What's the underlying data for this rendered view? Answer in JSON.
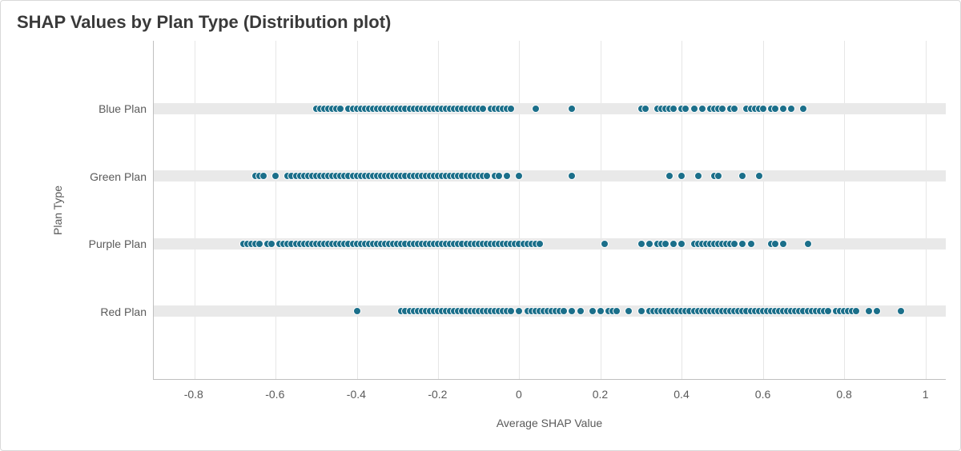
{
  "title": "SHAP Values by Plan Type (Distribution plot)",
  "ylabel": "Plan Type",
  "xlabel": "Average SHAP Value",
  "chart_data": {
    "type": "scatter",
    "xlim": [
      -0.9,
      1.05
    ],
    "xticks": [
      -0.8,
      -0.6,
      -0.4,
      -0.2,
      0,
      0.2,
      0.4,
      0.6,
      0.8,
      1
    ],
    "categories": [
      "Blue Plan",
      "Green Plan",
      "Purple Plan",
      "Red Plan"
    ],
    "dot_color": "#1b6f8a",
    "series": [
      {
        "name": "Blue Plan",
        "values": [
          -0.5,
          -0.49,
          -0.48,
          -0.47,
          -0.46,
          -0.45,
          -0.44,
          -0.42,
          -0.41,
          -0.4,
          -0.39,
          -0.38,
          -0.37,
          -0.36,
          -0.35,
          -0.34,
          -0.33,
          -0.32,
          -0.31,
          -0.3,
          -0.29,
          -0.28,
          -0.27,
          -0.26,
          -0.25,
          -0.24,
          -0.23,
          -0.22,
          -0.21,
          -0.2,
          -0.19,
          -0.18,
          -0.17,
          -0.16,
          -0.15,
          -0.14,
          -0.13,
          -0.12,
          -0.11,
          -0.1,
          -0.09,
          -0.07,
          -0.06,
          -0.05,
          -0.04,
          -0.03,
          -0.02,
          0.04,
          0.13,
          0.3,
          0.31,
          0.34,
          0.35,
          0.36,
          0.37,
          0.38,
          0.4,
          0.41,
          0.43,
          0.45,
          0.47,
          0.48,
          0.49,
          0.5,
          0.52,
          0.53,
          0.56,
          0.57,
          0.58,
          0.59,
          0.6,
          0.62,
          0.63,
          0.65,
          0.67,
          0.7
        ]
      },
      {
        "name": "Green Plan",
        "values": [
          -0.65,
          -0.64,
          -0.63,
          -0.6,
          -0.57,
          -0.56,
          -0.55,
          -0.54,
          -0.53,
          -0.52,
          -0.51,
          -0.5,
          -0.49,
          -0.48,
          -0.47,
          -0.46,
          -0.45,
          -0.44,
          -0.43,
          -0.42,
          -0.41,
          -0.4,
          -0.39,
          -0.38,
          -0.37,
          -0.36,
          -0.35,
          -0.34,
          -0.33,
          -0.32,
          -0.31,
          -0.3,
          -0.29,
          -0.28,
          -0.27,
          -0.26,
          -0.25,
          -0.24,
          -0.23,
          -0.22,
          -0.21,
          -0.2,
          -0.19,
          -0.18,
          -0.17,
          -0.16,
          -0.15,
          -0.14,
          -0.13,
          -0.12,
          -0.11,
          -0.1,
          -0.09,
          -0.08,
          -0.06,
          -0.05,
          -0.03,
          0.0,
          0.13,
          0.37,
          0.4,
          0.44,
          0.48,
          0.49,
          0.55,
          0.59
        ]
      },
      {
        "name": "Purple Plan",
        "values": [
          -0.68,
          -0.67,
          -0.66,
          -0.65,
          -0.64,
          -0.62,
          -0.61,
          -0.59,
          -0.58,
          -0.57,
          -0.56,
          -0.55,
          -0.54,
          -0.53,
          -0.52,
          -0.51,
          -0.5,
          -0.49,
          -0.48,
          -0.47,
          -0.46,
          -0.45,
          -0.44,
          -0.43,
          -0.42,
          -0.41,
          -0.4,
          -0.39,
          -0.38,
          -0.37,
          -0.36,
          -0.35,
          -0.34,
          -0.33,
          -0.32,
          -0.31,
          -0.3,
          -0.29,
          -0.28,
          -0.27,
          -0.26,
          -0.25,
          -0.24,
          -0.23,
          -0.22,
          -0.21,
          -0.2,
          -0.19,
          -0.18,
          -0.17,
          -0.16,
          -0.15,
          -0.14,
          -0.13,
          -0.12,
          -0.11,
          -0.1,
          -0.09,
          -0.08,
          -0.07,
          -0.06,
          -0.05,
          -0.04,
          -0.03,
          -0.02,
          -0.01,
          0.0,
          0.01,
          0.02,
          0.03,
          0.04,
          0.05,
          0.21,
          0.3,
          0.32,
          0.34,
          0.35,
          0.36,
          0.38,
          0.4,
          0.43,
          0.44,
          0.45,
          0.46,
          0.47,
          0.48,
          0.49,
          0.5,
          0.51,
          0.52,
          0.53,
          0.55,
          0.57,
          0.62,
          0.63,
          0.65,
          0.71
        ]
      },
      {
        "name": "Red Plan",
        "values": [
          -0.4,
          -0.29,
          -0.28,
          -0.27,
          -0.26,
          -0.25,
          -0.24,
          -0.23,
          -0.22,
          -0.21,
          -0.2,
          -0.19,
          -0.18,
          -0.17,
          -0.16,
          -0.15,
          -0.14,
          -0.13,
          -0.12,
          -0.11,
          -0.1,
          -0.09,
          -0.08,
          -0.07,
          -0.06,
          -0.05,
          -0.04,
          -0.03,
          -0.02,
          0.0,
          0.02,
          0.03,
          0.04,
          0.05,
          0.06,
          0.07,
          0.08,
          0.09,
          0.1,
          0.11,
          0.13,
          0.15,
          0.18,
          0.2,
          0.22,
          0.23,
          0.24,
          0.27,
          0.3,
          0.32,
          0.33,
          0.34,
          0.35,
          0.36,
          0.37,
          0.38,
          0.39,
          0.4,
          0.41,
          0.42,
          0.43,
          0.44,
          0.45,
          0.46,
          0.47,
          0.48,
          0.49,
          0.5,
          0.51,
          0.52,
          0.53,
          0.54,
          0.55,
          0.56,
          0.57,
          0.58,
          0.59,
          0.6,
          0.61,
          0.62,
          0.63,
          0.64,
          0.65,
          0.66,
          0.67,
          0.68,
          0.69,
          0.7,
          0.71,
          0.72,
          0.73,
          0.74,
          0.75,
          0.76,
          0.78,
          0.79,
          0.8,
          0.81,
          0.82,
          0.83,
          0.86,
          0.88,
          0.94
        ]
      }
    ]
  }
}
